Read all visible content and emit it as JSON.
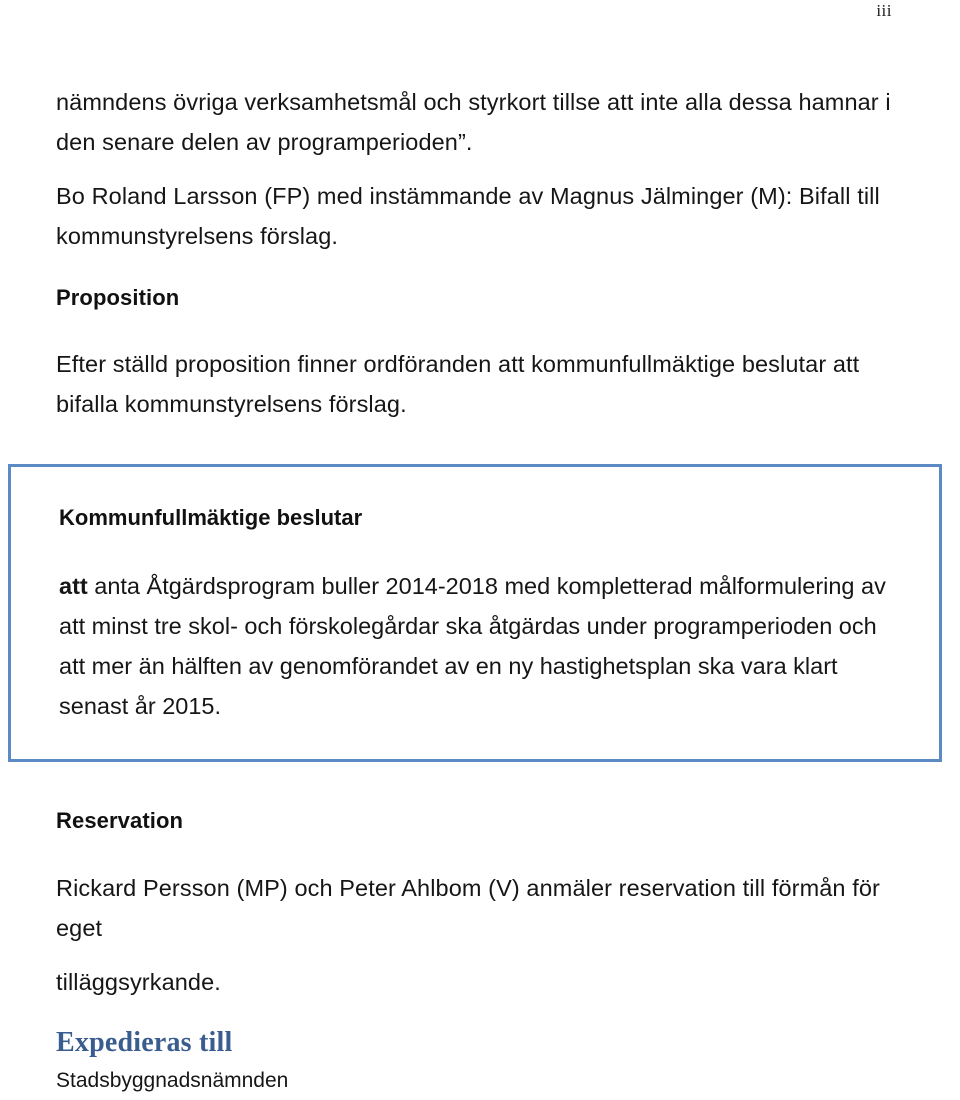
{
  "document": {
    "page_number": "iii",
    "language": "sv",
    "accent_color": "#3a5d8f",
    "box_border_color": "#5b8ac4"
  },
  "content": {
    "intro_paragraph": "nämndens övriga verksamhetsmål och styrkort tillse att inte alla dessa hamnar i den senare delen av programperioden”.",
    "speaker_paragraph": "Bo Roland Larsson (FP) med instämmande av Magnus Jälminger (M): Bifall till kommunstyrelsens förslag.",
    "proposition_heading": "Proposition",
    "proposition_paragraph": "Efter ställd proposition finner ordföranden att kommunfullmäktige beslutar att bifalla kommunstyrelsens förslag.",
    "decision_box": {
      "heading": "Kommunfullmäktige beslutar",
      "lead_word": "att",
      "body": " anta Åtgärdsprogram buller 2014-2018 med kompletterad målformulering av att minst tre skol- och förskolegårdar ska åtgärdas under programperioden och att mer än hälften av genomförandet av en ny hastighetsplan ska vara klart senast år 2015."
    },
    "reservation_heading": "Reservation",
    "reservation_paragraph": "Rickard Persson (MP) och Peter Ahlbom (V) anmäler reservation till förmån för eget",
    "reservation_paragraph_cont": "tilläggsyrkande.",
    "expedieras_heading": "Expedieras till",
    "expedieras_items": [
      "Stadsbyggnadsnämnden"
    ]
  }
}
